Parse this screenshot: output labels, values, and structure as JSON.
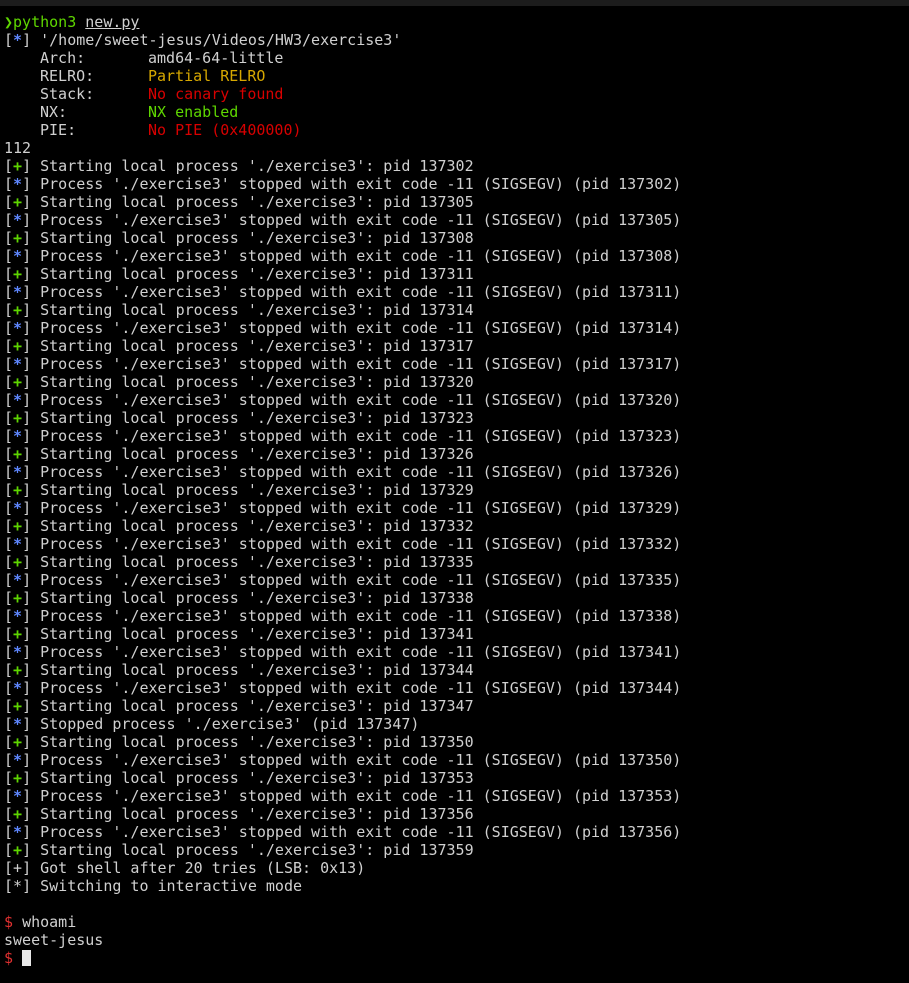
{
  "colors": {
    "background": "#000000",
    "foreground": "#d0d0d0",
    "green": "#5fd700",
    "blue": "#5f87ff",
    "yellow": "#d7a800",
    "red": "#d70000"
  },
  "command": {
    "prompt_symbol": "❯",
    "program": "python3",
    "argument": "new.py"
  },
  "binary_path": "'/home/sweet-jesus/Videos/HW3/exercise3'",
  "checksec": [
    {
      "label": "Arch:",
      "value": "amd64-64-little",
      "color": "default"
    },
    {
      "label": "RELRO:",
      "value": "Partial RELRO",
      "color": "yellow"
    },
    {
      "label": "Stack:",
      "value": "No canary found",
      "color": "red"
    },
    {
      "label": "NX:",
      "value": "NX enabled",
      "color": "green"
    },
    {
      "label": "PIE:",
      "value": "No PIE (0x400000)",
      "color": "red"
    }
  ],
  "offset_output": "112",
  "log_lines": [
    {
      "marker": "+",
      "text": "Starting local process './exercise3': pid 137302"
    },
    {
      "marker": "*",
      "text": "Process './exercise3' stopped with exit code -11 (SIGSEGV) (pid 137302)"
    },
    {
      "marker": "+",
      "text": "Starting local process './exercise3': pid 137305"
    },
    {
      "marker": "*",
      "text": "Process './exercise3' stopped with exit code -11 (SIGSEGV) (pid 137305)"
    },
    {
      "marker": "+",
      "text": "Starting local process './exercise3': pid 137308"
    },
    {
      "marker": "*",
      "text": "Process './exercise3' stopped with exit code -11 (SIGSEGV) (pid 137308)"
    },
    {
      "marker": "+",
      "text": "Starting local process './exercise3': pid 137311"
    },
    {
      "marker": "*",
      "text": "Process './exercise3' stopped with exit code -11 (SIGSEGV) (pid 137311)"
    },
    {
      "marker": "+",
      "text": "Starting local process './exercise3': pid 137314"
    },
    {
      "marker": "*",
      "text": "Process './exercise3' stopped with exit code -11 (SIGSEGV) (pid 137314)"
    },
    {
      "marker": "+",
      "text": "Starting local process './exercise3': pid 137317"
    },
    {
      "marker": "*",
      "text": "Process './exercise3' stopped with exit code -11 (SIGSEGV) (pid 137317)"
    },
    {
      "marker": "+",
      "text": "Starting local process './exercise3': pid 137320"
    },
    {
      "marker": "*",
      "text": "Process './exercise3' stopped with exit code -11 (SIGSEGV) (pid 137320)"
    },
    {
      "marker": "+",
      "text": "Starting local process './exercise3': pid 137323"
    },
    {
      "marker": "*",
      "text": "Process './exercise3' stopped with exit code -11 (SIGSEGV) (pid 137323)"
    },
    {
      "marker": "+",
      "text": "Starting local process './exercise3': pid 137326"
    },
    {
      "marker": "*",
      "text": "Process './exercise3' stopped with exit code -11 (SIGSEGV) (pid 137326)"
    },
    {
      "marker": "+",
      "text": "Starting local process './exercise3': pid 137329"
    },
    {
      "marker": "*",
      "text": "Process './exercise3' stopped with exit code -11 (SIGSEGV) (pid 137329)"
    },
    {
      "marker": "+",
      "text": "Starting local process './exercise3': pid 137332"
    },
    {
      "marker": "*",
      "text": "Process './exercise3' stopped with exit code -11 (SIGSEGV) (pid 137332)"
    },
    {
      "marker": "+",
      "text": "Starting local process './exercise3': pid 137335"
    },
    {
      "marker": "*",
      "text": "Process './exercise3' stopped with exit code -11 (SIGSEGV) (pid 137335)"
    },
    {
      "marker": "+",
      "text": "Starting local process './exercise3': pid 137338"
    },
    {
      "marker": "*",
      "text": "Process './exercise3' stopped with exit code -11 (SIGSEGV) (pid 137338)"
    },
    {
      "marker": "+",
      "text": "Starting local process './exercise3': pid 137341"
    },
    {
      "marker": "*",
      "text": "Process './exercise3' stopped with exit code -11 (SIGSEGV) (pid 137341)"
    },
    {
      "marker": "+",
      "text": "Starting local process './exercise3': pid 137344"
    },
    {
      "marker": "*",
      "text": "Process './exercise3' stopped with exit code -11 (SIGSEGV) (pid 137344)"
    },
    {
      "marker": "+",
      "text": "Starting local process './exercise3': pid 137347"
    },
    {
      "marker": "*",
      "text": "Stopped process './exercise3' (pid 137347)"
    },
    {
      "marker": "+",
      "text": "Starting local process './exercise3': pid 137350"
    },
    {
      "marker": "*",
      "text": "Process './exercise3' stopped with exit code -11 (SIGSEGV) (pid 137350)"
    },
    {
      "marker": "+",
      "text": "Starting local process './exercise3': pid 137353"
    },
    {
      "marker": "*",
      "text": "Process './exercise3' stopped with exit code -11 (SIGSEGV) (pid 137353)"
    },
    {
      "marker": "+",
      "text": "Starting local process './exercise3': pid 137356"
    },
    {
      "marker": "*",
      "text": "Process './exercise3' stopped with exit code -11 (SIGSEGV) (pid 137356)"
    },
    {
      "marker": "+",
      "text": "Starting local process './exercise3': pid 137359"
    }
  ],
  "result_lines": [
    {
      "marker": "+",
      "text": "Got shell after 20 tries (LSB: 0x13)"
    },
    {
      "marker": "*",
      "text": "Switching to interactive mode"
    }
  ],
  "shell": {
    "prompt": "$",
    "command": "whoami",
    "output": "sweet-jesus"
  }
}
